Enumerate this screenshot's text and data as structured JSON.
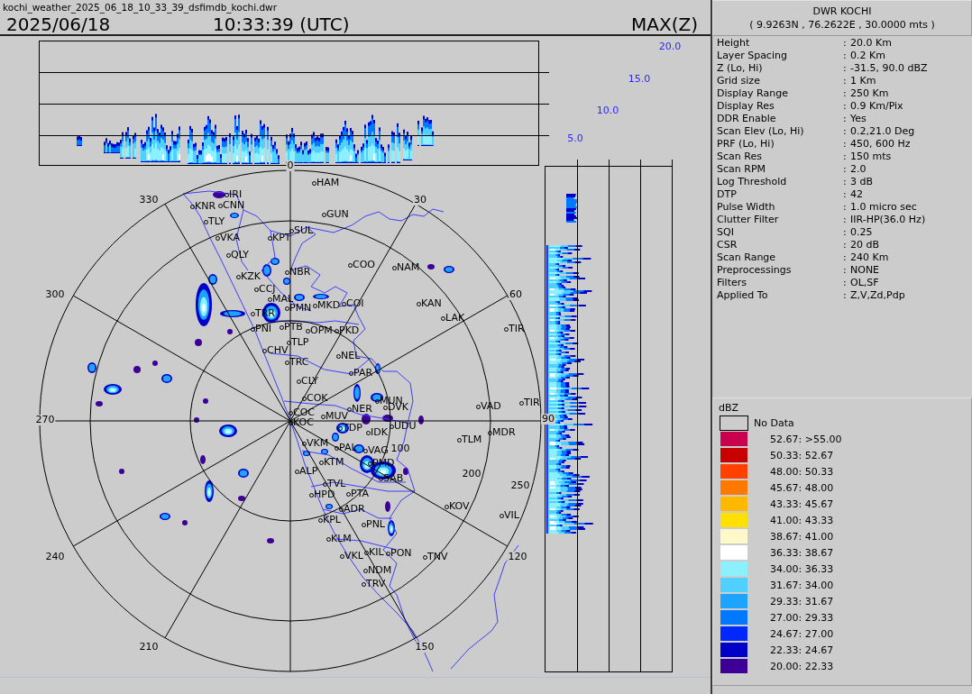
{
  "header": {
    "filename": "kochi_weather_2025_06_18_10_33_39_dsfimdb_kochi.dwr",
    "date": "2025/06/18",
    "time": "10:33:39 (UTC)",
    "product": "MAX(Z)"
  },
  "cross_section": {
    "height_labels": [
      "20.0",
      "15.0",
      "10.0",
      "5.0"
    ]
  },
  "radar_map": {
    "azimuth_labels": [
      "0",
      "30",
      "60",
      "90",
      "120",
      "150",
      "210",
      "240",
      "270",
      "300",
      "330"
    ],
    "range_labels": [
      "100",
      "200",
      "250"
    ],
    "stations": [
      "HAM",
      "IRI",
      "KNR",
      "CNN",
      "GUN",
      "TLY",
      "SUL",
      "VKA",
      "KPT",
      "QLY",
      "COO",
      "NAM",
      "NBR",
      "KZK",
      "CCJ",
      "MAL",
      "PMN",
      "MKD",
      "COI",
      "KAN",
      "TRR",
      "LAK",
      "PNI",
      "PTB",
      "OPM",
      "PKD",
      "TIR",
      "TLP",
      "CHV",
      "NEL",
      "TRC",
      "PAR",
      "CLY",
      "COK",
      "MUN",
      "TIR",
      "NER",
      "DVK",
      "VAD",
      "COC",
      "MUV",
      "KOC",
      "TDP",
      "UDU",
      "IDK",
      "MDR",
      "TLM",
      "VKM",
      "PAL",
      "VAG",
      "KTM",
      "PMD",
      "ALP",
      "SAB",
      "TVL",
      "HPD",
      "PTA",
      "ADR",
      "KOV",
      "VIL",
      "KPL",
      "PNL",
      "KLM",
      "VKL",
      "KIL",
      "PON",
      "TNV",
      "NDM",
      "TRV"
    ]
  },
  "station_info": {
    "name": "DWR KOCHI",
    "coordinates": "( 9.9263N , 76.2622E , 30.0000 mts )",
    "parameters": [
      {
        "label": "Height",
        "separator": ":",
        "value": "20.0 Km"
      },
      {
        "label": "Layer Spacing",
        "separator": ":",
        "value": "0.2 Km"
      },
      {
        "label": "Z (Lo, Hi)",
        "separator": ":",
        "value": "-31.5, 90.0 dBZ"
      },
      {
        "label": "Grid size",
        "separator": ":",
        "value": "1 Km"
      },
      {
        "label": "Display Range",
        "separator": ":",
        "value": "250 Km"
      },
      {
        "label": "Display Res",
        "separator": ":",
        "value": "0.9 Km/Pix"
      },
      {
        "label": "DDR Enable",
        "separator": ":",
        "value": "Yes"
      },
      {
        "label": "Scan Elev (Lo, Hi)",
        "separator": ":",
        "value": "0.2,21.0 Deg"
      },
      {
        "label": "PRF (Lo, Hi)",
        "separator": ":",
        "value": "450, 600 Hz"
      },
      {
        "label": "Scan Res",
        "separator": ":",
        "value": "150 mts"
      },
      {
        "label": "Scan RPM",
        "separator": ":",
        "value": "2.0"
      },
      {
        "label": "Log Threshold",
        "separator": ":",
        "value": "3 dB"
      },
      {
        "label": "DTP",
        "separator": ":",
        "value": "42"
      },
      {
        "label": "Pulse Width",
        "separator": ":",
        "value": "1.0 micro sec"
      },
      {
        "label": "Clutter Filter",
        "separator": ":",
        "value": "IIR-HP(36.0 Hz)"
      },
      {
        "label": "SQI",
        "separator": ":",
        "value": "0.25"
      },
      {
        "label": "CSR",
        "separator": ":",
        "value": "20 dB"
      },
      {
        "label": "Scan Range",
        "separator": ":",
        "value": "240 Km"
      },
      {
        "label": "Preprocessings",
        "separator": ":",
        "value": "NONE"
      },
      {
        "label": "Filters",
        "separator": ":",
        "value": "OL,SF"
      },
      {
        "label": "Applied To",
        "separator": ":",
        "value": "Z,V,Zd,Pdp"
      }
    ]
  },
  "legend": {
    "title": "dBZ",
    "items": [
      {
        "kind": "empty",
        "label": "No Data"
      },
      {
        "kind": "swatch",
        "label": "52.67: >55.00",
        "color": "#c8004e"
      },
      {
        "kind": "swatch",
        "label": "50.33: 52.67",
        "color": "#c80000"
      },
      {
        "kind": "swatch",
        "label": "48.00: 50.33",
        "color": "#ff4000"
      },
      {
        "kind": "swatch",
        "label": "45.67: 48.00",
        "color": "#ff7800"
      },
      {
        "kind": "swatch",
        "label": "43.33: 45.67",
        "color": "#ffb800"
      },
      {
        "kind": "swatch",
        "label": "41.00: 43.33",
        "color": "#ffe000"
      },
      {
        "kind": "swatch",
        "label": "38.67: 41.00",
        "color": "#fff8c8"
      },
      {
        "kind": "swatch",
        "label": "36.33: 38.67",
        "color": "#ffffff"
      },
      {
        "kind": "swatch",
        "label": "34.00: 36.33",
        "color": "#8cf0ff"
      },
      {
        "kind": "swatch",
        "label": "31.67: 34.00",
        "color": "#50d0ff"
      },
      {
        "kind": "swatch",
        "label": "29.33: 31.67",
        "color": "#1ca4ff"
      },
      {
        "kind": "swatch",
        "label": "27.00: 29.33",
        "color": "#0078ff"
      },
      {
        "kind": "swatch",
        "label": "24.67: 27.00",
        "color": "#0028ff"
      },
      {
        "kind": "swatch",
        "label": "22.33: 24.67",
        "color": "#0000c8"
      },
      {
        "kind": "swatch",
        "label": "20.00: 22.33",
        "color": "#3c0096"
      }
    ]
  }
}
